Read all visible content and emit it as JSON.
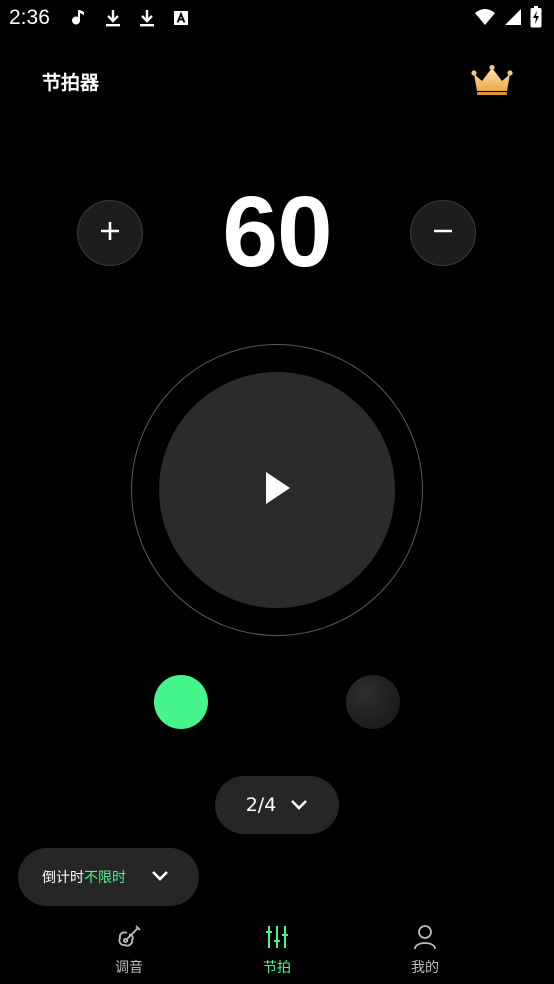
{
  "status_bar": {
    "time": "2:36",
    "left_icons": [
      "music-note-icon",
      "download-icon",
      "download-icon",
      "text-a-icon"
    ],
    "right_icons": [
      "wifi-icon",
      "signal-icon",
      "battery-charging-icon"
    ]
  },
  "header": {
    "title": "节拍器",
    "premium_icon": "crown-icon"
  },
  "tempo": {
    "bpm": "60",
    "increase_icon": "plus-icon",
    "decrease_icon": "minus-icon"
  },
  "player": {
    "play_icon": "play-icon"
  },
  "beats": {
    "active_color": "#47f58d",
    "count": 2,
    "current": 1
  },
  "time_signature": {
    "value": "2/4"
  },
  "countdown": {
    "label": "倒计时",
    "value": "不限时"
  },
  "bottom_nav": {
    "items": [
      {
        "label": "调音",
        "icon": "guitar-icon",
        "active": false
      },
      {
        "label": "节拍",
        "icon": "sliders-icon",
        "active": true
      },
      {
        "label": "我的",
        "icon": "user-icon",
        "active": false
      }
    ]
  },
  "colors": {
    "accent": "#47f58d",
    "background": "#000000",
    "surface": "#262626"
  }
}
